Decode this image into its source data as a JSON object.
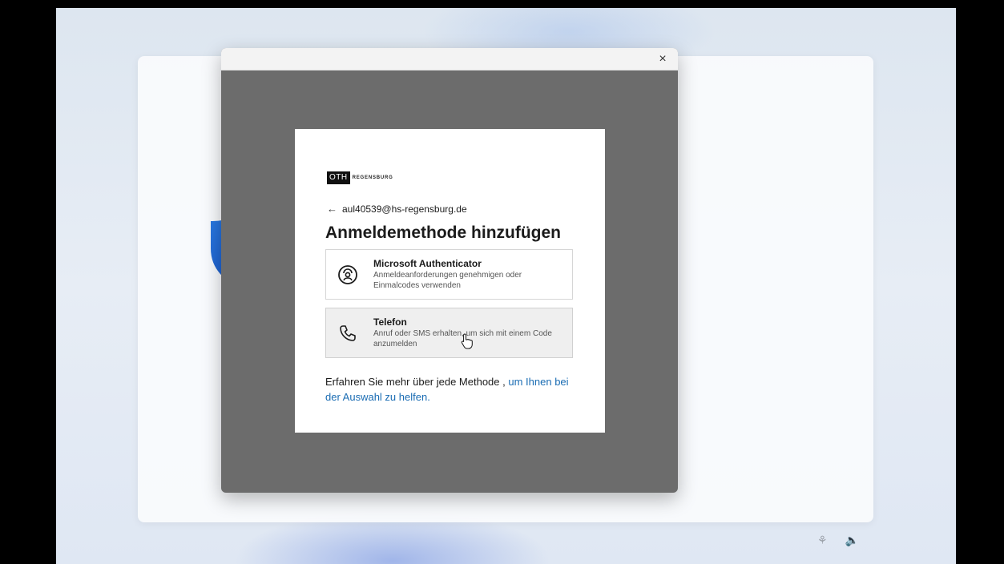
{
  "dialog": {
    "close_glyph": "×"
  },
  "signin": {
    "logo_box": "OTH",
    "logo_text": "REGENSBURG",
    "back_glyph": "←",
    "account": "aul40539@hs-regensburg.de",
    "heading": "Anmeldemethode hinzufügen",
    "options": [
      {
        "title": "Microsoft Authenticator",
        "description": "Anmeldeanforderungen genehmigen oder Einmalcodes verwenden",
        "icon": "authenticator-lock-icon"
      },
      {
        "title": "Telefon",
        "description": "Anruf oder SMS erhalten, um sich mit einem Code anzumelden",
        "icon": "phone-icon"
      }
    ],
    "learn_more_text": "Erfahren Sie mehr über jede Methode ,",
    "learn_more_link": "um Ihnen bei der Auswahl zu helfen."
  },
  "colors": {
    "link": "#1a6cb3",
    "shield": "#1e63d6",
    "dialog_backdrop": "#6c6c6c"
  }
}
